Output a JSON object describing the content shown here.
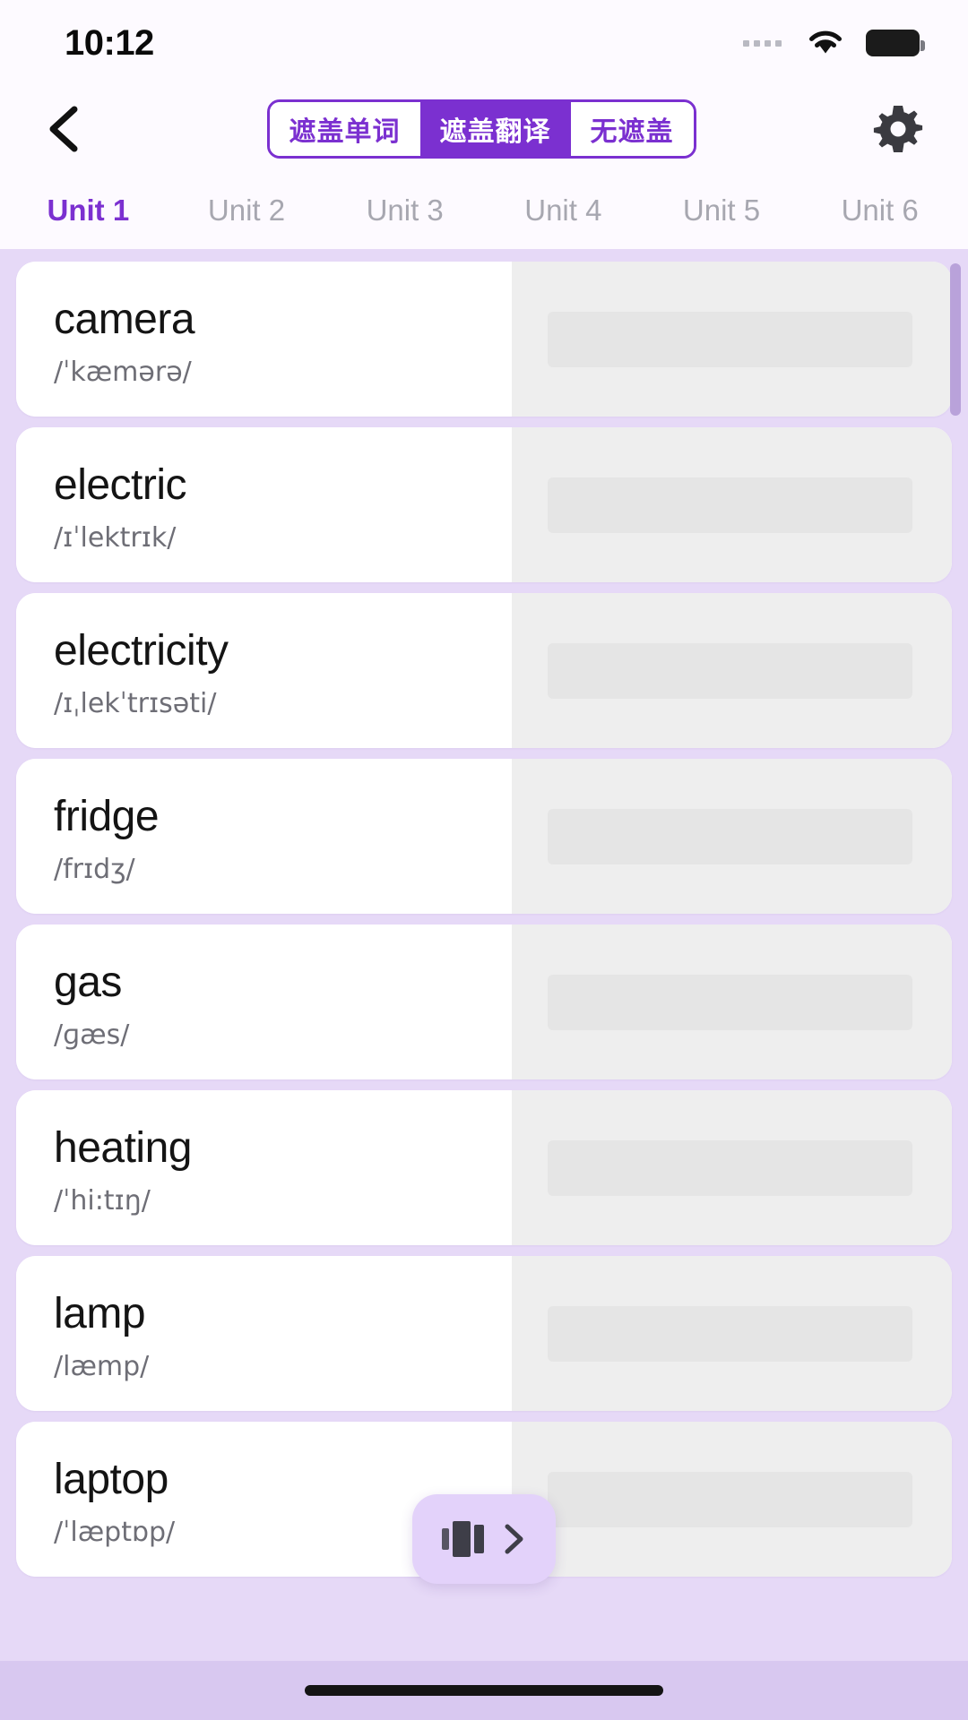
{
  "status_bar": {
    "time": "10:12",
    "signal_icon": "signal-dots-icon",
    "wifi_icon": "wifi-icon",
    "battery_icon": "battery-full-icon"
  },
  "nav": {
    "back_icon": "back-chevron-icon",
    "settings_icon": "gear-icon",
    "mode_segments": [
      {
        "label": "遮盖单词",
        "active": false
      },
      {
        "label": "遮盖翻译",
        "active": true
      },
      {
        "label": "无遮盖",
        "active": false
      }
    ]
  },
  "unit_tabs": [
    {
      "label": "Unit 1",
      "active": true
    },
    {
      "label": "Unit 2",
      "active": false
    },
    {
      "label": "Unit 3",
      "active": false
    },
    {
      "label": "Unit 4",
      "active": false
    },
    {
      "label": "Unit 5",
      "active": false
    },
    {
      "label": "Unit 6",
      "active": false
    }
  ],
  "words": [
    {
      "word": "camera",
      "phonetic": "/ˈkæmərə/",
      "translation_masked": true
    },
    {
      "word": "electric",
      "phonetic": "/ɪˈlektrɪk/",
      "translation_masked": true
    },
    {
      "word": "electricity",
      "phonetic": "/ɪˌlekˈtrɪsəti/",
      "translation_masked": true
    },
    {
      "word": "fridge",
      "phonetic": "/frɪdʒ/",
      "translation_masked": true
    },
    {
      "word": "gas",
      "phonetic": "/ɡæs/",
      "translation_masked": true
    },
    {
      "word": "heating",
      "phonetic": "/ˈhi:tɪŋ/",
      "translation_masked": true
    },
    {
      "word": "lamp",
      "phonetic": "/læmp/",
      "translation_masked": true
    },
    {
      "word": "laptop",
      "phonetic": "/ˈlæptɒp/",
      "translation_masked": true
    }
  ],
  "floating_button": {
    "cards_icon": "card-stack-icon",
    "arrow_icon": "chevron-right-icon"
  },
  "colors": {
    "accent": "#7b30d0",
    "header_bg": "#fdfaff",
    "list_bg": "#e6d9f7",
    "card_bg": "#ffffff",
    "mask_bg": "#eeeeee",
    "fab_bg": "#e3d2fa"
  }
}
